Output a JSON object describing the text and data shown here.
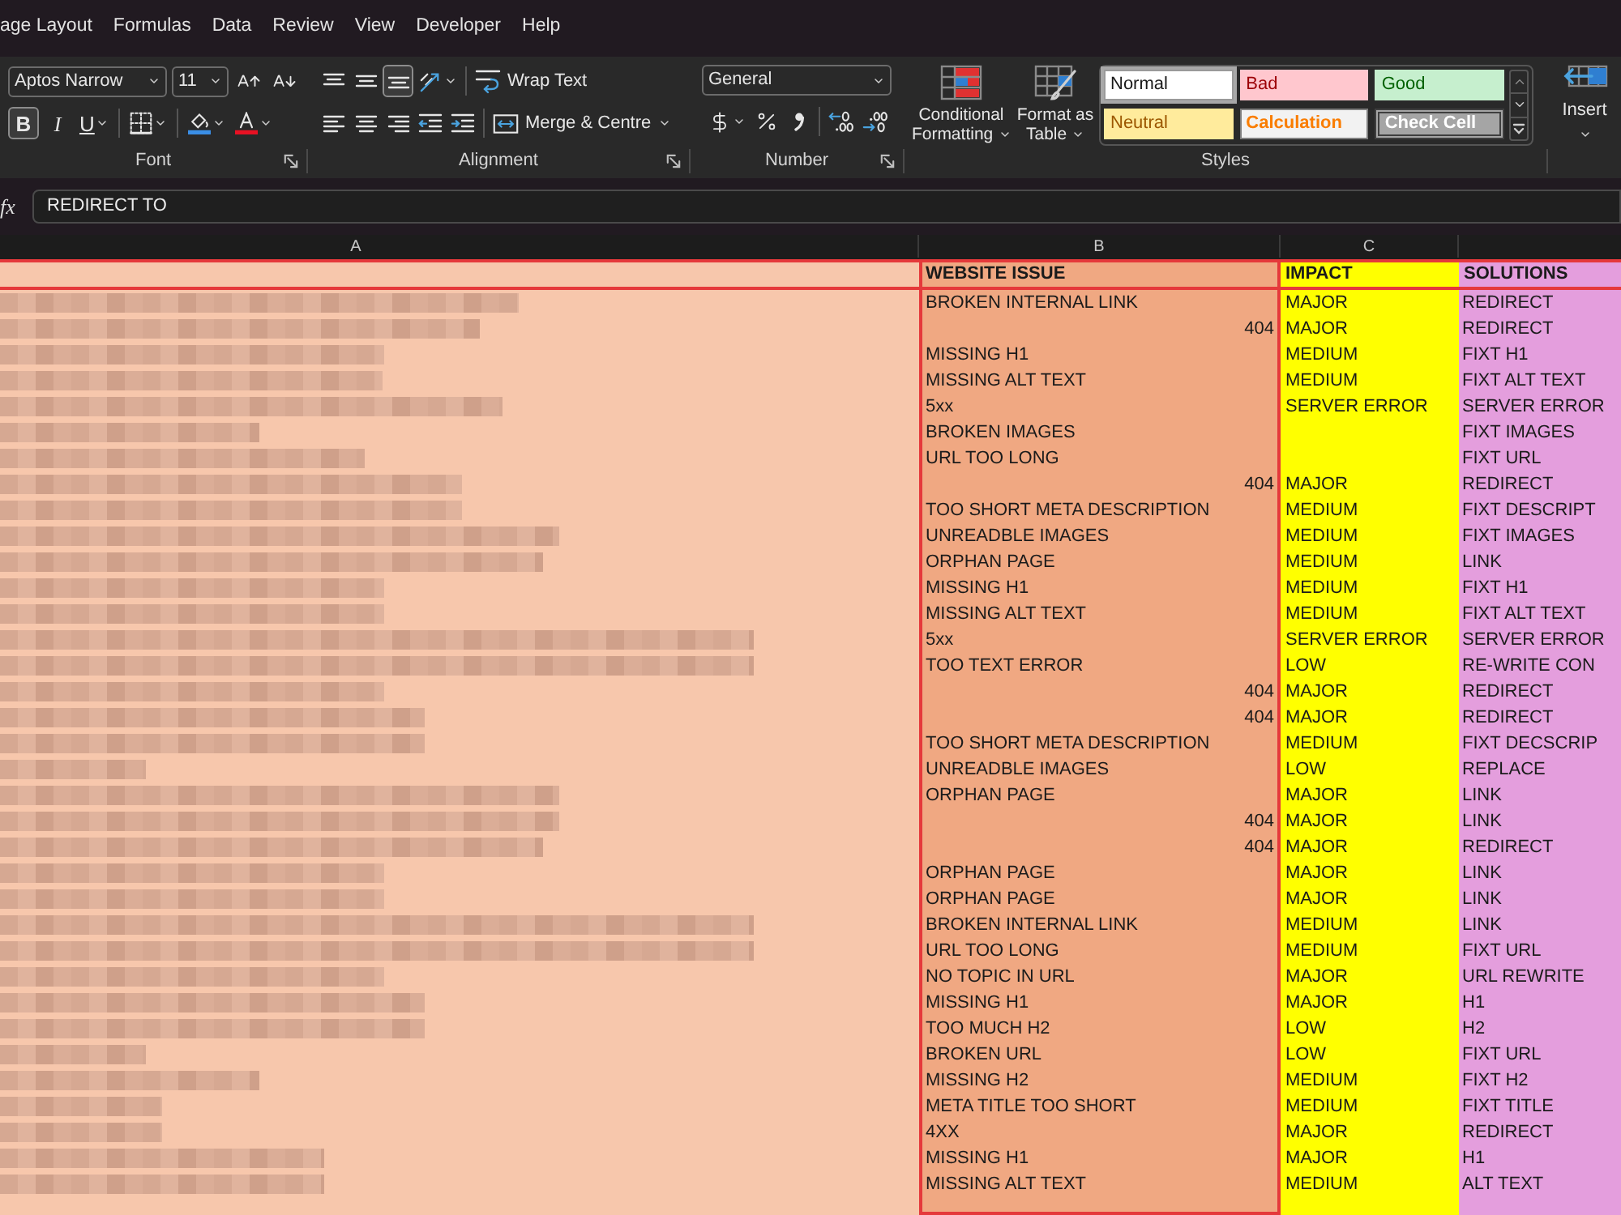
{
  "menu_tabs": [
    {
      "label": "age Layout",
      "selected": false
    },
    {
      "label": "Formulas",
      "selected": false
    },
    {
      "label": "Data",
      "selected": false
    },
    {
      "label": "Review",
      "selected": false
    },
    {
      "label": "View",
      "selected": false
    },
    {
      "label": "Developer",
      "selected": false
    },
    {
      "label": "Help",
      "selected": false
    }
  ],
  "ribbon": {
    "font": {
      "label": "Font",
      "font_name": "Aptos Narrow",
      "font_size": "11",
      "size_tools": [
        {
          "kind": "grow-font"
        },
        {
          "kind": "shrink-font"
        }
      ],
      "tools": [
        {
          "kind": "bold",
          "label": "B",
          "on": true
        },
        {
          "kind": "italic",
          "label": "I",
          "on": false
        },
        {
          "kind": "underline",
          "label": "U",
          "on": false
        },
        {
          "kind": "borders"
        },
        {
          "kind": "fill-color"
        },
        {
          "kind": "font-color"
        }
      ]
    },
    "alignment": {
      "label": "Alignment",
      "top_tools": [
        {
          "kind": "align-top",
          "on": false
        },
        {
          "kind": "align-middle",
          "on": false
        },
        {
          "kind": "align-bottom",
          "on": true
        },
        {
          "kind": "orientation"
        }
      ],
      "wrap_text": "Wrap Text",
      "bottom_tools": [
        {
          "kind": "align-left"
        },
        {
          "kind": "align-center"
        },
        {
          "kind": "align-right"
        },
        {
          "kind": "indent-decrease"
        },
        {
          "kind": "indent-increase"
        }
      ],
      "merge": "Merge & Centre"
    },
    "number": {
      "label": "Number",
      "format": "General",
      "tools": [
        {
          "kind": "currency"
        },
        {
          "kind": "percent"
        },
        {
          "kind": "comma"
        },
        {
          "kind": "decimal-increase"
        },
        {
          "kind": "decimal-decrease"
        }
      ]
    },
    "styles": {
      "label": "Styles",
      "conditional_formatting": "Conditional Formatting",
      "format_as_table": "Format as Table",
      "gallery": [
        {
          "label": "Normal",
          "kind": "normal",
          "selected": true
        },
        {
          "label": "Bad",
          "kind": "bad",
          "selected": false
        },
        {
          "label": "Good",
          "kind": "good",
          "selected": false
        },
        {
          "label": "Neutral",
          "kind": "neutral",
          "selected": false
        },
        {
          "label": "Calculation",
          "kind": "calculation",
          "selected": false
        },
        {
          "label": "Check Cell",
          "kind": "check",
          "selected": false
        }
      ]
    },
    "cells": {
      "insert": "Insert"
    }
  },
  "formula_bar": {
    "function_label": "fx",
    "value": "REDIRECT TO"
  },
  "column_headers": [
    "A",
    "B",
    "C"
  ],
  "sheet": {
    "header": {
      "website_issue": "WEBSITE ISSUE",
      "impact": "IMPACT",
      "solutions": "SOLUTIONS"
    },
    "rows": [
      {
        "kind": "text",
        "issue": "BROKEN INTERNAL LINK",
        "impact": "MAJOR",
        "solution": "REDIRECT"
      },
      {
        "kind": "number",
        "issue": "404",
        "impact": "MAJOR",
        "solution": "REDIRECT"
      },
      {
        "kind": "text",
        "issue": "MISSING H1",
        "impact": "MEDIUM",
        "solution": "FIXT H1"
      },
      {
        "kind": "text",
        "issue": "MISSING ALT TEXT",
        "impact": "MEDIUM",
        "solution": "FIXT ALT TEXT"
      },
      {
        "kind": "text",
        "issue": "5xx",
        "impact": "SERVER ERROR",
        "solution": "SERVER ERROR"
      },
      {
        "kind": "text",
        "issue": "BROKEN IMAGES",
        "solution": "FIXT IMAGES"
      },
      {
        "kind": "text",
        "issue": "URL TOO LONG",
        "solution": "FIXT URL"
      },
      {
        "kind": "number",
        "issue": "404",
        "impact": "MAJOR",
        "solution": "REDIRECT"
      },
      {
        "kind": "text",
        "issue": "TOO SHORT META DESCRIPTION",
        "impact": "MEDIUM",
        "solution": "FIXT DESCRIPT"
      },
      {
        "kind": "text",
        "issue": "UNREADBLE IMAGES",
        "impact": "MEDIUM",
        "solution": "FIXT IMAGES"
      },
      {
        "kind": "text",
        "issue": "ORPHAN PAGE",
        "impact": "MEDIUM",
        "solution": "LINK"
      },
      {
        "kind": "text",
        "issue": "MISSING H1",
        "impact": "MEDIUM",
        "solution": "FIXT H1"
      },
      {
        "kind": "text",
        "issue": "MISSING ALT TEXT",
        "impact": "MEDIUM",
        "solution": "FIXT ALT TEXT"
      },
      {
        "kind": "text",
        "issue": "5xx",
        "impact": "SERVER ERROR",
        "solution": "SERVER ERROR"
      },
      {
        "kind": "text",
        "issue": "TOO TEXT ERROR",
        "impact": "LOW",
        "solution": "RE-WRITE CON"
      },
      {
        "kind": "number",
        "issue": "404",
        "impact": "MAJOR",
        "solution": "REDIRECT"
      },
      {
        "kind": "number",
        "issue": "404",
        "impact": "MAJOR",
        "solution": "REDIRECT"
      },
      {
        "kind": "text",
        "issue": "TOO SHORT META DESCRIPTION",
        "impact": "MEDIUM",
        "solution": "FIXT DECSCRIP"
      },
      {
        "kind": "text",
        "issue": "UNREADBLE IMAGES",
        "impact": "LOW",
        "solution": "REPLACE"
      },
      {
        "kind": "text",
        "issue": "ORPHAN PAGE",
        "impact": "MAJOR",
        "solution": "LINK"
      },
      {
        "kind": "number",
        "issue": "404",
        "impact": "MAJOR",
        "solution": "LINK"
      },
      {
        "kind": "number",
        "issue": "404",
        "impact": "MAJOR",
        "solution": "REDIRECT"
      },
      {
        "kind": "text",
        "issue": "ORPHAN PAGE",
        "impact": "MAJOR",
        "solution": "LINK"
      },
      {
        "kind": "text",
        "issue": "ORPHAN PAGE",
        "impact": "MAJOR",
        "solution": "LINK"
      },
      {
        "kind": "text",
        "issue": "BROKEN INTERNAL LINK",
        "impact": "MEDIUM",
        "solution": "LINK"
      },
      {
        "kind": "text",
        "issue": "URL TOO LONG",
        "impact": "MEDIUM",
        "solution": "FIXT URL"
      },
      {
        "kind": "text",
        "issue": "NO TOPIC IN URL",
        "impact": "MAJOR",
        "solution": "URL REWRITE"
      },
      {
        "kind": "text",
        "issue": "MISSING H1",
        "impact": "MAJOR",
        "solution": "H1"
      },
      {
        "kind": "text",
        "issue": "TOO MUCH H2",
        "impact": "LOW",
        "solution": "H2"
      },
      {
        "kind": "text",
        "issue": "BROKEN URL",
        "impact": "LOW",
        "solution": "FIXT URL"
      },
      {
        "kind": "text",
        "issue": "MISSING H2",
        "impact": "MEDIUM",
        "solution": "FIXT H2"
      },
      {
        "kind": "text",
        "issue": "META TITLE TOO SHORT",
        "impact": "MEDIUM",
        "solution": "FIXT TITLE"
      },
      {
        "kind": "text",
        "issue": "4XX",
        "impact": "MAJOR",
        "solution": "REDIRECT"
      },
      {
        "kind": "text",
        "issue": "MISSING H1",
        "impact": "MAJOR",
        "solution": "H1"
      },
      {
        "kind": "text",
        "issue": "MISSING ALT TEXT",
        "impact": "MEDIUM",
        "solution": "ALT TEXT"
      }
    ]
  }
}
